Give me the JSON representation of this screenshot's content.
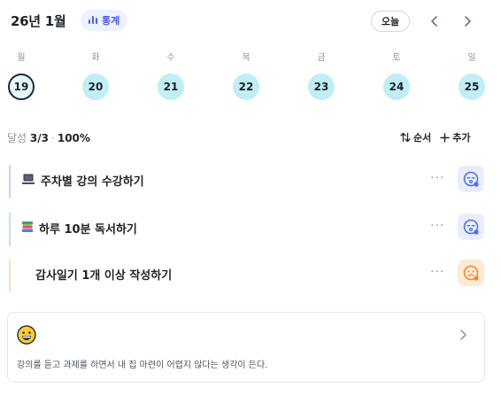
{
  "header": {
    "month_title": "26년 1월",
    "stats_label": "통계",
    "today_label": "오늘"
  },
  "week": {
    "weekdays": [
      "월",
      "화",
      "수",
      "목",
      "금",
      "토",
      "일"
    ],
    "dates": [
      "19",
      "20",
      "21",
      "22",
      "23",
      "24",
      "25"
    ],
    "selected_index": 0
  },
  "summary": {
    "label": "달성",
    "count": "3/3",
    "percent": "100%",
    "sort_label": "순서",
    "add_label": "추가"
  },
  "tasks": [
    {
      "icon": "laptop-icon",
      "text": "주차별 강의 수강하기",
      "bar_color": "#c9d2ff",
      "mood": "sleepy-face-icon",
      "mood_color": "#4b6cf0",
      "mood_bg": "#e8edff"
    },
    {
      "icon": "books-icon",
      "text": "하루 10분 독서하기",
      "bar_color": "#bfead3",
      "mood": "sleepy-face-icon",
      "mood_color": "#4b6cf0",
      "mood_bg": "#e8edff"
    },
    {
      "icon": "",
      "text": "감사일기 1개 이상 작성하기",
      "bar_color": "#fbe0c0",
      "mood": "sad-face-icon",
      "mood_color": "#f08a24",
      "mood_bg": "#ffead6"
    }
  ],
  "diary": {
    "emoji": "grinning-face-icon",
    "text": "강의를 듣고 과제를 하면서 내 집 마련이 어렵지 않다는 생각이 든다."
  },
  "colors": {
    "accent": "#4b5cf0",
    "day_bg": "#bfeef5",
    "today_border": "#1f2937"
  }
}
